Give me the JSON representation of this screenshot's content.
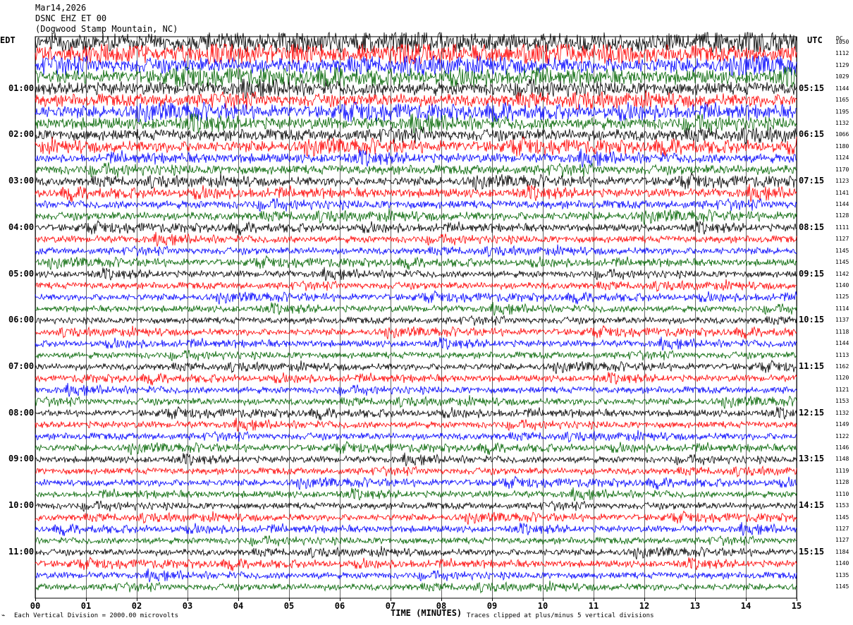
{
  "header": {
    "date": "Mar14,2026",
    "station": "DSNC EHZ ET 00",
    "location": "(Dogwood Stamp Mountain, NC)"
  },
  "left_zone": "EDT",
  "right_zone": "UTC",
  "dc_header": "DC",
  "footer": {
    "scale": "Each Vertical Division = 2000.00 microvolts",
    "xaxis_title": "TIME (MINUTES)",
    "clip_note": "Traces clipped at plus/minus 5 vertical divisions"
  },
  "chart_data": {
    "type": "line",
    "title": "DSNC EHZ ET 00",
    "xlabel": "TIME (MINUTES)",
    "ylabel": "",
    "xlim": [
      0,
      15
    ],
    "x_ticks": [
      "00",
      "01",
      "02",
      "03",
      "04",
      "05",
      "06",
      "07",
      "08",
      "09",
      "10",
      "11",
      "12",
      "13",
      "14",
      "15"
    ],
    "grid": true,
    "trace_colors": [
      "#000000",
      "#ff0000",
      "#0000ff",
      "#006400"
    ],
    "left_hour_labels": [
      "01:00",
      "02:00",
      "03:00",
      "04:00",
      "05:00",
      "06:00",
      "07:00",
      "08:00",
      "09:00",
      "10:00",
      "11:00"
    ],
    "right_hour_labels": [
      "05:15",
      "06:15",
      "07:15",
      "08:15",
      "09:15",
      "10:15",
      "11:15",
      "12:15",
      "13:15",
      "14:15",
      "15:15"
    ],
    "dc_offsets": [
      1050,
      1112,
      1129,
      1029,
      1144,
      1165,
      1195,
      1132,
      1066,
      1180,
      1124,
      1170,
      1123,
      1141,
      1144,
      1128,
      1111,
      1127,
      1145,
      1145,
      1142,
      1140,
      1125,
      1114,
      1137,
      1118,
      1144,
      1113,
      1162,
      1120,
      1121,
      1153,
      1132,
      1149,
      1122,
      1146,
      1148,
      1119,
      1128,
      1110,
      1153,
      1145,
      1127,
      1127,
      1184,
      1140,
      1135,
      1145
    ],
    "trace_activity": [
      1.0,
      0.95,
      0.9,
      0.85,
      0.75,
      0.7,
      0.7,
      0.65,
      0.6,
      0.55,
      0.4,
      0.4,
      0.35,
      0.35,
      0.3,
      0.3,
      0.22,
      0.2,
      0.18,
      0.18,
      0.17,
      0.17,
      0.16,
      0.16,
      0.16,
      0.16,
      0.16,
      0.16,
      0.16,
      0.16,
      0.17,
      0.17,
      0.17,
      0.17,
      0.17,
      0.16,
      0.16,
      0.16,
      0.16,
      0.16,
      0.16,
      0.16,
      0.16,
      0.16,
      0.16,
      0.17,
      0.16,
      0.16
    ]
  }
}
